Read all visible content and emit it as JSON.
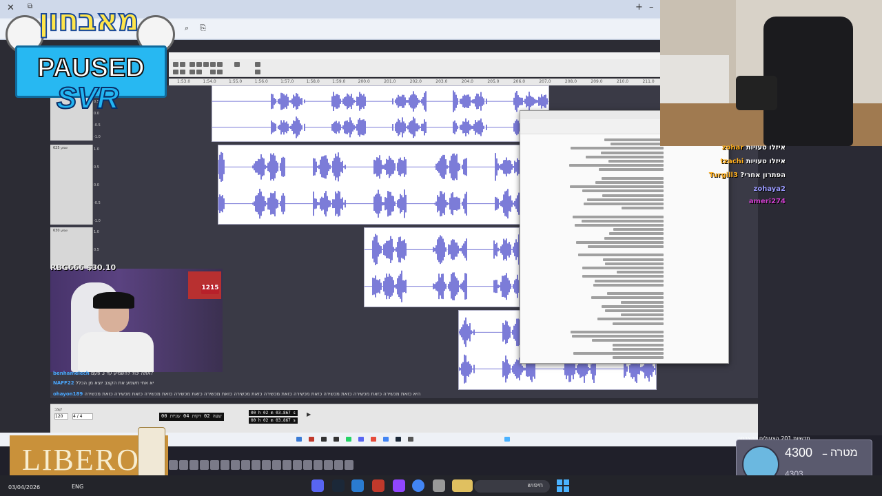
{
  "overlay": {
    "logo_title": "מאבחון",
    "paused": "PAUSED",
    "svr": "SVR",
    "cam_label": "RBG666 $30.10",
    "cam_badge": "1215",
    "libero": "LIBERO"
  },
  "daw": {
    "ruler_labels": [
      "1:53.0",
      "1:54.0",
      "1:55.0",
      "1:56.0",
      "1:57.0",
      "1:58.0",
      "1:59.0",
      "200.0",
      "201.0",
      "202.0",
      "203.0",
      "204.0",
      "205.0",
      "206.0",
      "207.0",
      "208.0",
      "209.0",
      "210.0",
      "211.0"
    ],
    "tracks": [
      {
        "name": "625 שמע",
        "scale": [
          "1.0",
          "0.5",
          "0.0",
          "-0.5",
          "-1.0"
        ]
      },
      {
        "name": "630 שמע",
        "scale": [
          "1.0",
          "0.5",
          "0.0",
          "-0.5",
          "-1.0"
        ]
      }
    ],
    "bottom": {
      "rate_label": "קצב",
      "rate_value": "120",
      "meter_value": "4 / 4",
      "time_main": "00 שעה 02 דקות 04 שניות",
      "sel_start": "00 h 02 m 03.867 s",
      "sel_end": "00 h 02 m 03.867 s"
    }
  },
  "chat_overlay": {
    "line1_user": "benhamelech",
    "line1_text": "אתה יכול להשמיע עד 3 פעם?",
    "line2_user": "NAFF22",
    "line2_text": "יא אחי תשמע את הקצב יוצא מן הכלל",
    "line3_user": "ohayon189",
    "line3_text": "היא כזאת מכשירה כזאת מכשירה כזאת מכשירה כזאת מכשירה כזאת מכשירה כזאת מכשירה כזאת מכשירה כזאת מכשירה כזאת מכשירה כזאת מכשירה כזאת מכשירה"
  },
  "twitch_chat": [
    {
      "user": "zohar",
      "text": "איזלו טעויות"
    },
    {
      "user": "tzachi",
      "text": "איזלו טעויות"
    },
    {
      "user": "Turgill3",
      "text": "?הפתרון אחרי"
    },
    {
      "user": "zohaya2",
      "text": ""
    },
    {
      "user": "ameri274",
      "text": ""
    }
  ],
  "goal": {
    "target": "4300",
    "separator": "–",
    "label": "מטרה",
    "current": "4303",
    "ticker": "מדשיות 201 הצעולים כהצבתה"
  },
  "taskbar": {
    "date": "03/04/2026",
    "lang": "ENG",
    "search": "חיפוש"
  }
}
